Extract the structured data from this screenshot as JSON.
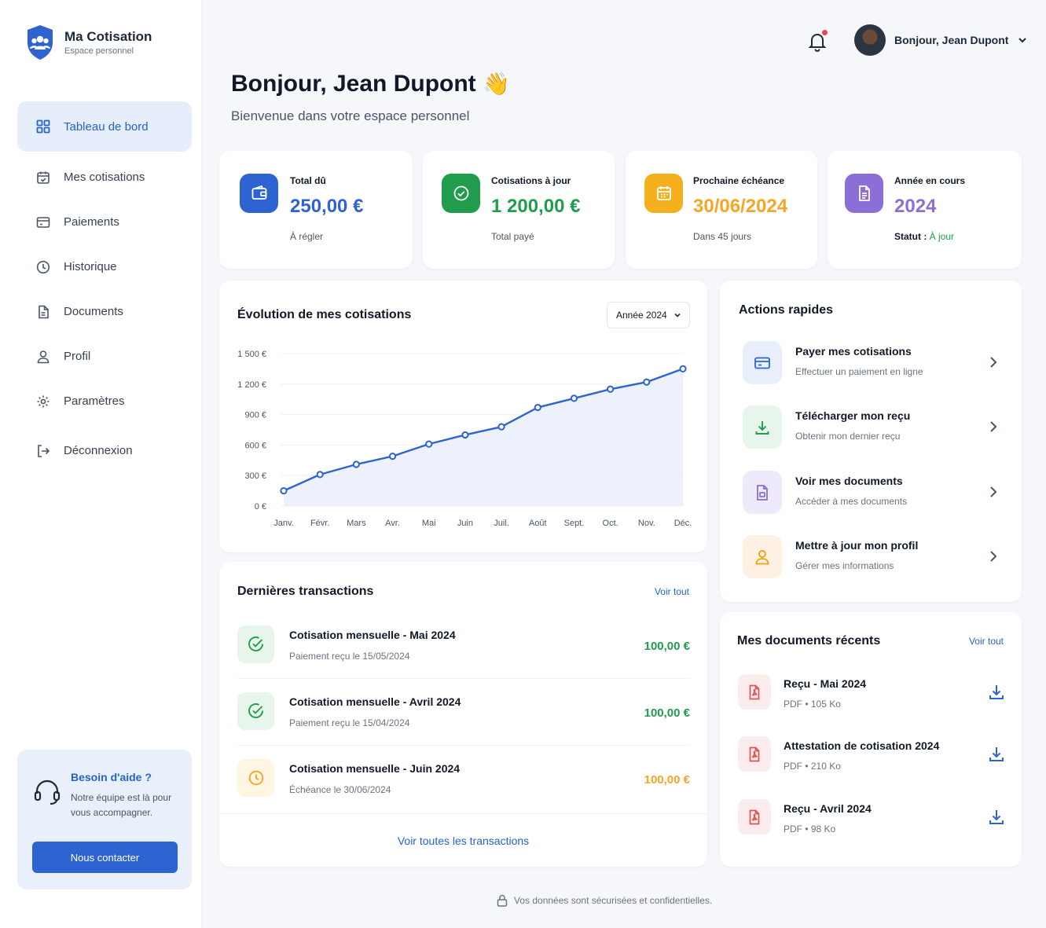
{
  "brand": {
    "name": "Ma Cotisation",
    "subtitle": "Espace personnel"
  },
  "nav": [
    {
      "label": "Tableau de bord",
      "icon": "grid-icon",
      "active": true
    },
    {
      "label": "Mes cotisations",
      "icon": "calendar-check-icon"
    },
    {
      "label": "Paiements",
      "icon": "card-icon"
    },
    {
      "label": "Historique",
      "icon": "clock-icon"
    },
    {
      "label": "Documents",
      "icon": "document-icon"
    },
    {
      "label": "Profil",
      "icon": "user-icon"
    },
    {
      "label": "Paramètres",
      "icon": "gear-icon"
    },
    {
      "label": "Déconnexion",
      "icon": "logout-icon"
    }
  ],
  "help": {
    "title": "Besoin d'aide ?",
    "text": "Notre équipe est là pour vous accompagner.",
    "button": "Nous contacter"
  },
  "header": {
    "user_greeting": "Bonjour, Jean Dupont",
    "notification_dot_color": "#ef4444"
  },
  "page": {
    "title": "Bonjour, Jean Dupont",
    "wave": "👋",
    "subtitle": "Bienvenue dans votre espace personnel"
  },
  "stats": [
    {
      "label": "Total dû",
      "value": "250,00 €",
      "note": "À régler",
      "color": "#2e63d2",
      "icon": "wallet-icon"
    },
    {
      "label": "Cotisations à jour",
      "value": "1 200,00 €",
      "note": "Total payé",
      "color": "#1f9d4d",
      "icon": "check-circle-icon"
    },
    {
      "label": "Prochaine échéance",
      "value": "30/06/2024",
      "note": "Dans 45 jours",
      "color": "#f5a623",
      "icon": "calendar-icon"
    },
    {
      "label": "Année en cours",
      "value": "2024",
      "note_prefix": "Statut : ",
      "note_status": "À jour",
      "color": "#8b6fd6",
      "icon": "document-icon"
    }
  ],
  "chart_card": {
    "title": "Évolution de mes cotisations",
    "select_value": "Année 2024"
  },
  "chart_data": {
    "type": "area",
    "categories": [
      "Janv.",
      "Févr.",
      "Mars",
      "Avr.",
      "Mai",
      "Juin",
      "Juil.",
      "Août",
      "Sept.",
      "Oct.",
      "Nov.",
      "Déc."
    ],
    "values": [
      150,
      310,
      410,
      490,
      610,
      700,
      780,
      970,
      1060,
      1150,
      1220,
      1350
    ],
    "yticks": [
      "0 €",
      "300 €",
      "600 €",
      "900 €",
      "1 200 €",
      "1 500 €"
    ],
    "ylim": [
      0,
      1500
    ],
    "grid": true,
    "line_color": "#2e63d2"
  },
  "transactions": {
    "title": "Dernières transactions",
    "link": "Voir tout",
    "items": [
      {
        "title": "Cotisation mensuelle - Mai 2024",
        "sub": "Paiement reçu le 15/05/2024",
        "amount": "100,00 €",
        "status": "paid",
        "icon": "check-circle-icon"
      },
      {
        "title": "Cotisation mensuelle - Avril 2024",
        "sub": "Paiement reçu le 15/04/2024",
        "amount": "100,00 €",
        "status": "paid",
        "icon": "check-circle-icon"
      },
      {
        "title": "Cotisation mensuelle - Juin 2024",
        "sub": "Échéance le 30/06/2024",
        "amount": "100,00 €",
        "status": "pending",
        "icon": "clock-icon"
      }
    ],
    "all_link": "Voir toutes les transactions"
  },
  "quick_actions": {
    "title": "Actions rapides",
    "items": [
      {
        "title": "Payer mes cotisations",
        "sub": "Effectuer un paiement en ligne",
        "icon": "card-icon"
      },
      {
        "title": "Télécharger mon reçu",
        "sub": "Obtenir mon dernier reçu",
        "icon": "download-icon"
      },
      {
        "title": "Voir mes documents",
        "sub": "Accéder à mes documents",
        "icon": "document-icon"
      },
      {
        "title": "Mettre à jour mon profil",
        "sub": "Gérer mes informations",
        "icon": "user-icon"
      }
    ]
  },
  "documents": {
    "title": "Mes documents récents",
    "link": "Voir tout",
    "items": [
      {
        "title": "Reçu - Mai 2024",
        "meta": "PDF • 105 Ko",
        "icon": "pdf-icon"
      },
      {
        "title": "Attestation de cotisation 2024",
        "meta": "PDF • 210 Ko",
        "icon": "pdf-icon"
      },
      {
        "title": "Reçu - Avril 2024",
        "meta": "PDF • 98 Ko",
        "icon": "pdf-icon"
      }
    ]
  },
  "footer": {
    "text": "Vos données sont sécurisées et confidentielles."
  }
}
